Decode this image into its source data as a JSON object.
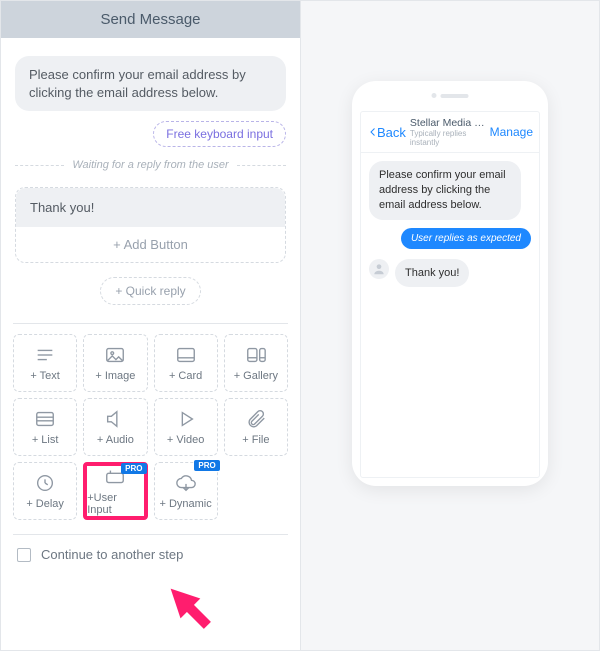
{
  "panel": {
    "title": "Send Message",
    "confirm_bubble": "Please confirm your email address by clicking the email address below.",
    "free_input_pill": "Free keyboard input",
    "waiting_text": "Waiting for a reply from the user",
    "thank_you": "Thank you!",
    "add_button": "+ Add Button",
    "quick_reply": "+ Quick reply",
    "continue_label": "Continue to another step"
  },
  "tiles": {
    "text": "+ Text",
    "image": "+ Image",
    "card": "+ Card",
    "gallery": "+ Gallery",
    "list": "+ List",
    "audio": "+ Audio",
    "video": "+ Video",
    "file": "+ File",
    "delay": "+ Delay",
    "user_input": "+User Input",
    "dynamic": "+ Dynamic",
    "pro_badge": "PRO"
  },
  "phone": {
    "back": "Back",
    "title": "Stellar Media Marketi...",
    "subtitle": "Typically replies instantly",
    "manage": "Manage",
    "msg1": "Please confirm your email address by clicking the email address below.",
    "reply": "User replies as expected",
    "msg2": "Thank you!"
  }
}
